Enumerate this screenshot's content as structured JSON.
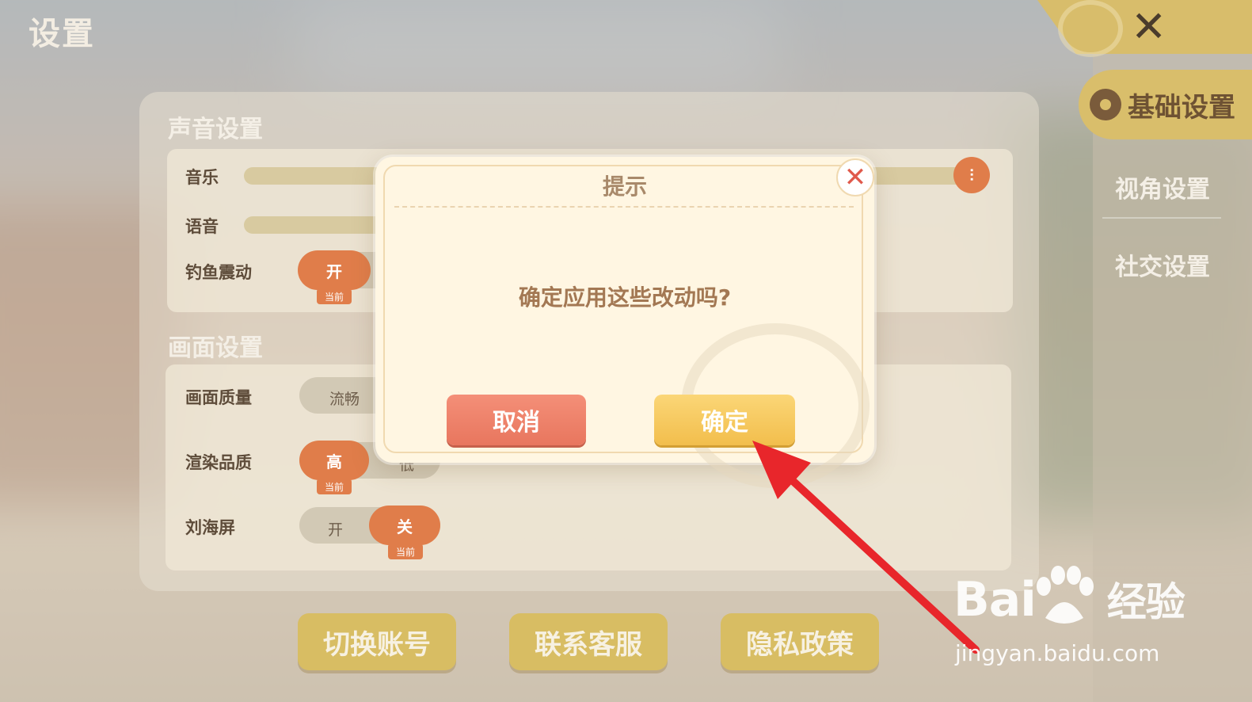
{
  "page": {
    "title": "设置"
  },
  "nav": {
    "close_label": "✕",
    "items": [
      {
        "label": "基础设置",
        "active": true
      },
      {
        "label": "视角设置",
        "active": false
      },
      {
        "label": "社交设置",
        "active": false
      }
    ]
  },
  "sound": {
    "section_title": "声音设置",
    "music_label": "音乐",
    "voice_label": "语音",
    "fish_vibe_label": "钓鱼震动",
    "fish_vibe_on": "开",
    "current_tag": "当前"
  },
  "display": {
    "section_title": "画面设置",
    "quality_label": "画面质量",
    "quality_value": "流畅",
    "render_label": "渲染品质",
    "render_high": "高",
    "render_low": "低",
    "notch_label": "刘海屏",
    "notch_on": "开",
    "notch_off": "关",
    "current_tag": "当前"
  },
  "bottom_buttons": {
    "switch_account": "切换账号",
    "contact_support": "联系客服",
    "privacy_policy": "隐私政策"
  },
  "dialog": {
    "title": "提示",
    "message": "确定应用这些改动吗?",
    "cancel": "取消",
    "confirm": "确定",
    "close_label": "✕"
  },
  "watermark": {
    "brand": "Bai",
    "brand_suffix": "经验",
    "url": "jingyan.baidu.com"
  },
  "colors": {
    "accent_orange": "#e07d4a",
    "gold": "#d8bd63",
    "cancel_red": "#f48f78",
    "confirm_yellow": "#f2be4c",
    "arrow_red": "#e8262b"
  }
}
